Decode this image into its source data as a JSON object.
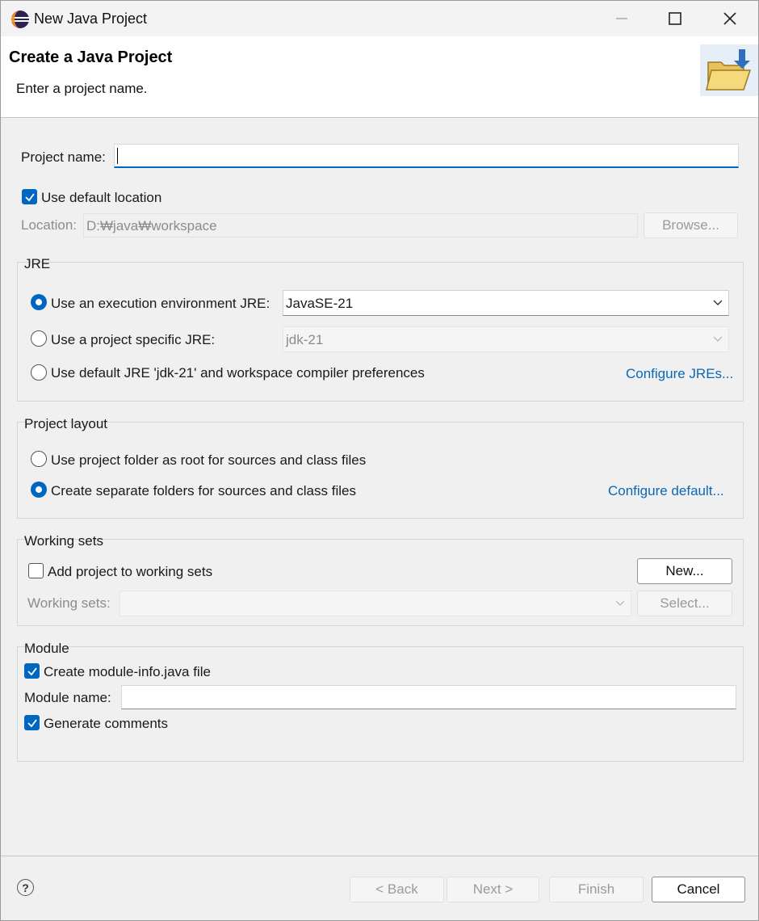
{
  "window": {
    "title": "New Java Project"
  },
  "banner": {
    "title": "Create a Java Project",
    "message": "Enter a project name."
  },
  "project": {
    "name_label": "Project name:",
    "name_value": "",
    "use_default_label": "Use default location",
    "use_default_checked": true,
    "location_label": "Location:",
    "location_value": "D:₩java₩workspace",
    "browse_label": "Browse..."
  },
  "jre": {
    "title": "JRE",
    "option1_label": "Use an execution environment JRE:",
    "option1_value": "JavaSE-21",
    "option2_label": "Use a project specific JRE:",
    "option2_value": "jdk-21",
    "option3_label": "Use default JRE 'jdk-21' and workspace compiler preferences",
    "configure_link": "Configure JREs...",
    "selected": "option1"
  },
  "layout": {
    "title": "Project layout",
    "option1_label": "Use project folder as root for sources and class files",
    "option2_label": "Create separate folders for sources and class files",
    "configure_link": "Configure default...",
    "selected": "option2"
  },
  "working_sets": {
    "title": "Working sets",
    "add_label": "Add project to working sets",
    "add_checked": false,
    "new_button": "New...",
    "sets_label": "Working sets:",
    "sets_value": "",
    "select_button": "Select..."
  },
  "module": {
    "title": "Module",
    "create_label": "Create module-info.java file",
    "create_checked": true,
    "name_label": "Module name:",
    "name_value": "",
    "comments_label": "Generate comments",
    "comments_checked": true
  },
  "footer": {
    "help": "?",
    "back": "< Back",
    "next": "Next >",
    "finish": "Finish",
    "cancel": "Cancel"
  },
  "colors": {
    "accent": "#0067c0",
    "link": "#0a68b6"
  }
}
